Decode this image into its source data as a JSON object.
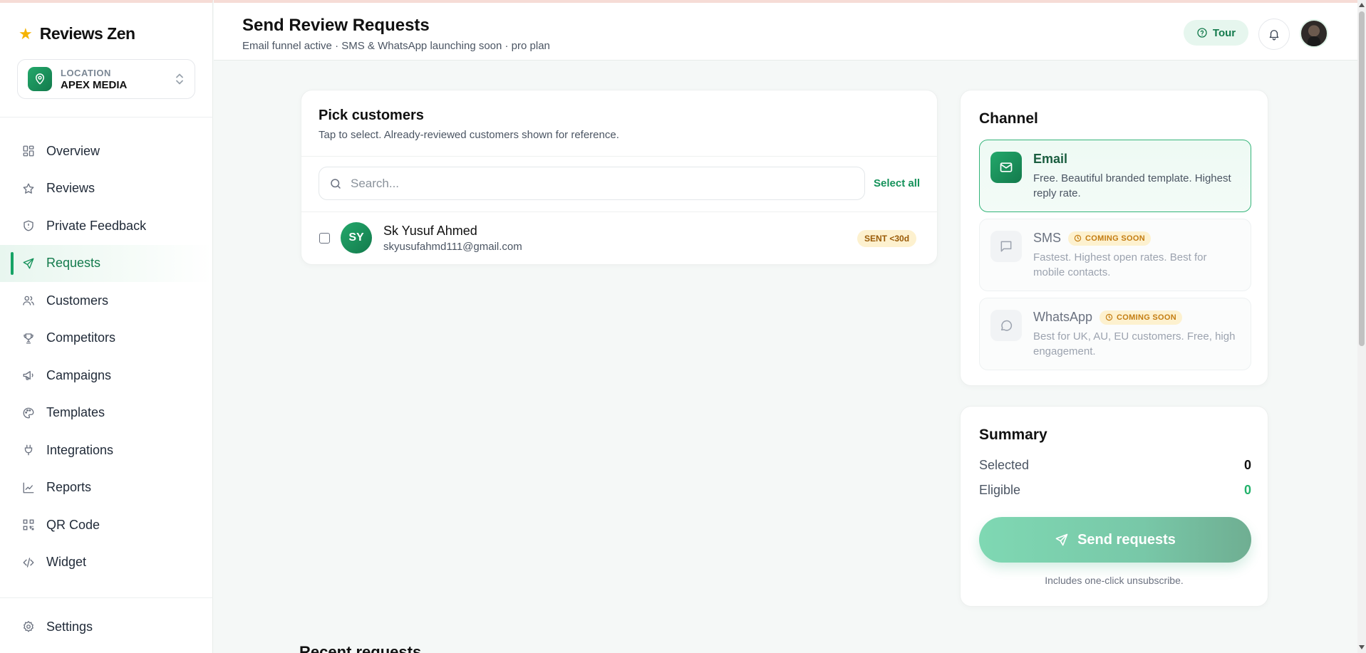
{
  "brand": {
    "name": "Reviews Zen"
  },
  "location": {
    "label": "LOCATION",
    "value": "APEX MEDIA"
  },
  "nav": [
    {
      "label": "Overview",
      "icon": "grid-icon"
    },
    {
      "label": "Reviews",
      "icon": "star-icon"
    },
    {
      "label": "Private Feedback",
      "icon": "shield-icon"
    },
    {
      "label": "Requests",
      "icon": "send-icon",
      "active": true
    },
    {
      "label": "Customers",
      "icon": "users-icon"
    },
    {
      "label": "Competitors",
      "icon": "trophy-icon"
    },
    {
      "label": "Campaigns",
      "icon": "megaphone-icon"
    },
    {
      "label": "Templates",
      "icon": "palette-icon"
    },
    {
      "label": "Integrations",
      "icon": "plug-icon"
    },
    {
      "label": "Reports",
      "icon": "chart-icon"
    },
    {
      "label": "QR Code",
      "icon": "qr-icon"
    },
    {
      "label": "Widget",
      "icon": "code-icon"
    }
  ],
  "settings": {
    "label": "Settings"
  },
  "header": {
    "title": "Send Review Requests",
    "subtitle": "Email funnel active · SMS & WhatsApp launching soon · pro plan",
    "tour_label": "Tour"
  },
  "pick": {
    "title": "Pick customers",
    "description": "Tap to select. Already-reviewed customers shown for reference.",
    "search_placeholder": "Search...",
    "select_all": "Select all",
    "customers": [
      {
        "initials": "SY",
        "name": "Sk Yusuf Ahmed",
        "email": "skyusufahmd111@gmail.com",
        "badge": "SENT <30d",
        "checked": false
      }
    ]
  },
  "channel": {
    "title": "Channel",
    "options": [
      {
        "name": "Email",
        "description": "Free. Beautiful branded template. Highest reply rate.",
        "selected": true
      },
      {
        "name": "SMS",
        "badge": "COMING SOON",
        "description": "Fastest. Highest open rates. Best for mobile contacts.",
        "disabled": true
      },
      {
        "name": "WhatsApp",
        "badge": "COMING SOON",
        "description": "Best for UK, AU, EU customers. Free, high engagement.",
        "disabled": true
      }
    ]
  },
  "summary": {
    "title": "Summary",
    "selected_label": "Selected",
    "selected_value": "0",
    "eligible_label": "Eligible",
    "eligible_value": "0",
    "send_label": "Send requests",
    "footnote": "Includes one-click unsubscribe."
  },
  "recent": {
    "title": "Recent requests"
  },
  "colors": {
    "accent": "#16a365",
    "accent_dark": "#137a4c",
    "badge_bg": "#fdf1cf",
    "badge_text": "#9a5b07"
  }
}
